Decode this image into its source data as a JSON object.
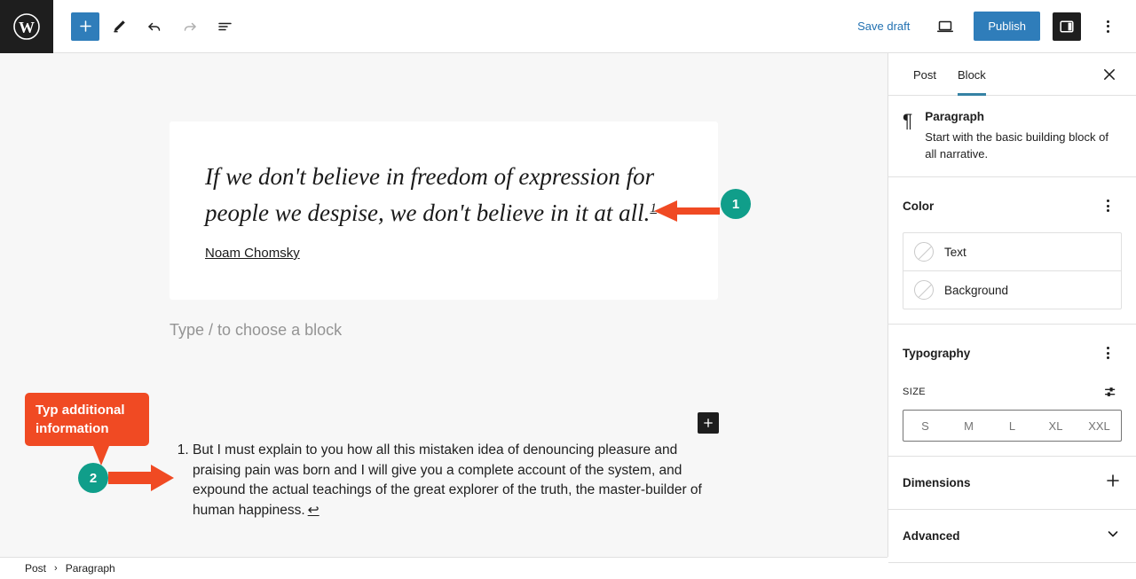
{
  "topbar": {
    "logo_icon": "wordpress-logo-icon",
    "add_block_label": "+",
    "tools_icon": "pencil-icon",
    "undo_icon": "undo-arrow-icon",
    "redo_icon": "redo-arrow-icon",
    "list_view_icon": "list-view-icon",
    "save_draft_label": "Save draft",
    "preview_icon": "desktop-preview-icon",
    "publish_label": "Publish",
    "sidebar_toggle_icon": "sidebar-panel-icon",
    "options_icon": "kebab-menu-icon",
    "accent_blue": "#2f7dba"
  },
  "editor": {
    "quote": {
      "text": "If we don't believe in freedom of expression for people we despise, we don't believe in it at all.",
      "footnote_ref": "1",
      "citation": "Noam Chomsky",
      "background": "#ffffff"
    },
    "empty_paragraph_placeholder": "Type / to choose a block",
    "inserter_label": "+",
    "footnotes": [
      {
        "number": "1.",
        "text": "But I must explain to you how all this mistaken idea of denouncing pleasure and praising pain was born and I will give you a complete account of the system, and expound the actual teachings of the great explorer of the truth, the master-builder of human happiness.",
        "back_link_icon": "return-arrow-icon",
        "back_link_glyph": "↩"
      }
    ],
    "canvas_background": "#f7f7f7"
  },
  "annotations": {
    "accent_orange": "#f04a23",
    "badge_teal": "#109e8a",
    "markers": [
      {
        "id": "1",
        "label": "1"
      },
      {
        "id": "2",
        "label": "2"
      }
    ],
    "tooltip": {
      "text": "Typ additional information"
    }
  },
  "sidebar": {
    "tabs": [
      {
        "label": "Post",
        "active": false
      },
      {
        "label": "Block",
        "active": true
      }
    ],
    "close_icon": "close-icon",
    "active_underline": "#3582a4",
    "block_card": {
      "icon": "paragraph-pilcrow-icon",
      "icon_glyph": "¶",
      "title": "Paragraph",
      "description": "Start with the basic building block of all narrative."
    },
    "color_section": {
      "title": "Color",
      "options_icon": "kebab-menu-icon",
      "swatches": [
        {
          "label": "Text",
          "value": "none"
        },
        {
          "label": "Background",
          "value": "none"
        }
      ]
    },
    "typography_section": {
      "title": "Typography",
      "options_icon": "kebab-menu-icon",
      "size_label": "SIZE",
      "size_settings_icon": "sliders-icon",
      "sizes": [
        "S",
        "M",
        "L",
        "XL",
        "XXL"
      ],
      "selected_size": ""
    },
    "dimensions_section": {
      "title": "Dimensions",
      "toggle_icon": "plus-icon"
    },
    "advanced_section": {
      "title": "Advanced",
      "toggle_icon": "chevron-down-icon"
    }
  },
  "breadcrumb": {
    "items": [
      "Post",
      "Paragraph"
    ],
    "separator": "›"
  }
}
